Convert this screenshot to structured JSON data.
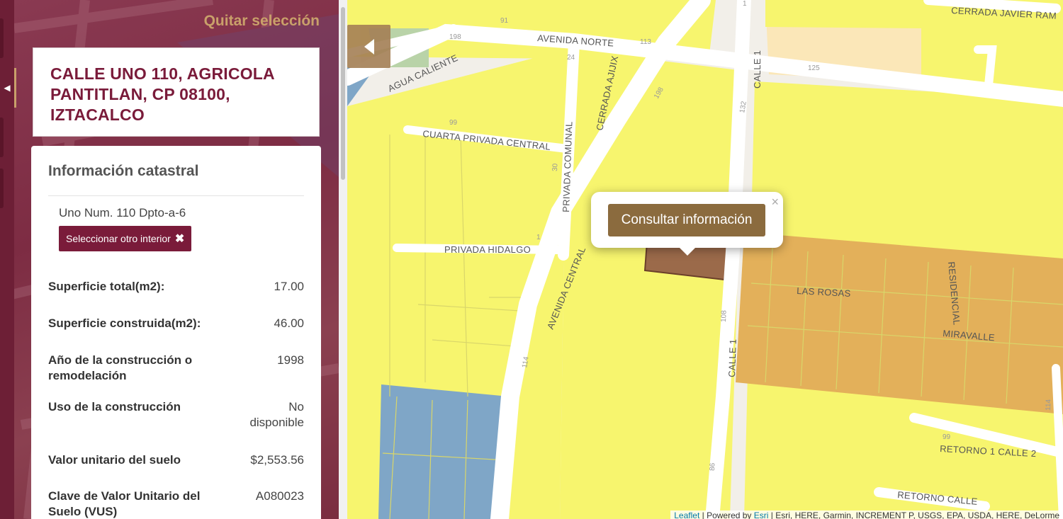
{
  "panel": {
    "clear_selection": "Quitar selección",
    "address": "CALLE UNO 110, AGRICOLA PANTITLAN, CP 08100, IZTACALCO",
    "info_title": "Información catastral",
    "unit_line": "Uno Num. 110 Dpto-a-6",
    "select_other": "Seleccionar otro interior",
    "rows": [
      {
        "label": "Superficie total(m2):",
        "value": "17.00"
      },
      {
        "label": "Superficie construida(m2):",
        "value": "46.00"
      },
      {
        "label": "Año de la construcción o remodelación",
        "value": "1998"
      },
      {
        "label": "Uso de la construcción",
        "value": "No disponible"
      },
      {
        "label": "Valor unitario del suelo",
        "value": "$2,553.56"
      },
      {
        "label": "Clave de Valor Unitario del Suelo (VUS)",
        "value": "A080023"
      }
    ]
  },
  "map": {
    "popup_button": "Consultar información",
    "popup_close": "×",
    "attribution_leaflet": "Leaflet",
    "attribution_powered": " | Powered by ",
    "attribution_esri": "Esri",
    "attribution_rest": " | Esri, HERE, Garmin, INCREMENT P, USGS, EPA, USDA, HERE, DeLorme",
    "streets": {
      "avenida_norte": "AVENIDA NORTE",
      "agua_caliente": "AGUA CALIENTE",
      "cuarta_privada": "CUARTA PRIVADA CENTRAL",
      "privada_comunal": "PRIVADA COMUNAL",
      "cerrada_ajijix": "CERRADA AJIJIX",
      "calle1_top": "CALLE 1",
      "calle1_mid": "CALLE 1",
      "privada_hidalgo": "PRIVADA HIDALGO",
      "avenida_central": "AVENIDA CENTRAL",
      "las_rosas": "LAS ROSAS",
      "residencial": "RESIDENCIAL",
      "miravalle": "MIRAVALLE",
      "cerrada_javier": "CERRADA JAVIER RAM",
      "retorno1": "RETORNO 1 CALLE 2",
      "retorno_calle": "RETORNO CALLE"
    },
    "numbers": [
      "91",
      "113",
      "198",
      "125",
      "99",
      "132",
      "198",
      "30",
      "1",
      "114",
      "108",
      "86",
      "99",
      "114",
      "24",
      "1"
    ]
  },
  "colors": {
    "maroon": "#7a1b3a",
    "gold": "#c9a06a",
    "zone_yellow": "#f7f56e",
    "zone_orange": "#e3b05a",
    "zone_blue": "#7fa6c7",
    "selected_parcel": "#9b6a4a"
  }
}
